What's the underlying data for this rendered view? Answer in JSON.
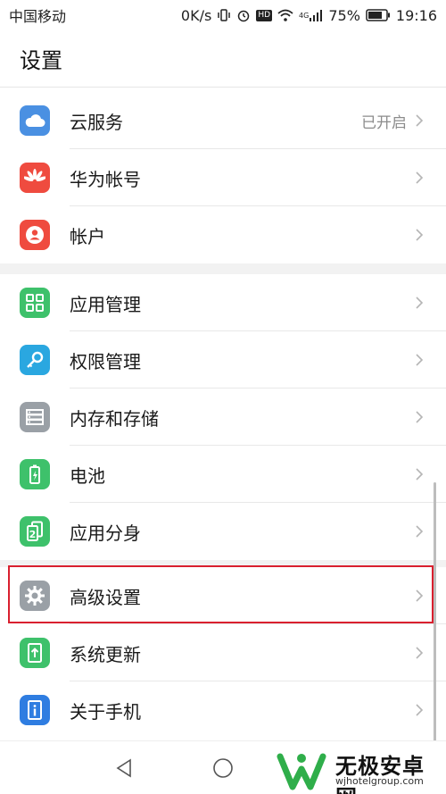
{
  "status_bar": {
    "carrier": "中国移动",
    "speed": "0K/s",
    "hd_badge": "HD",
    "network": "4G",
    "battery": "75%",
    "time": "19:16"
  },
  "header": {
    "title": "设置"
  },
  "groups": [
    {
      "items": [
        {
          "icon": "cloud-icon",
          "color": "#4a90e2",
          "label": "云服务",
          "value": "已开启"
        },
        {
          "icon": "huawei-logo-icon",
          "color": "#ef4b3f",
          "label": "华为帐号",
          "value": ""
        },
        {
          "icon": "user-icon",
          "color": "#ef4b3f",
          "label": "帐户",
          "value": ""
        }
      ]
    },
    {
      "items": [
        {
          "icon": "app-grid-icon",
          "color": "#3ec16b",
          "label": "应用管理",
          "value": ""
        },
        {
          "icon": "key-icon",
          "color": "#2aa7e0",
          "label": "权限管理",
          "value": ""
        },
        {
          "icon": "storage-icon",
          "color": "#9aa0a6",
          "label": "内存和存储",
          "value": ""
        },
        {
          "icon": "battery-icon",
          "color": "#3ec16b",
          "label": "电池",
          "value": ""
        },
        {
          "icon": "twin-app-icon",
          "color": "#3ec16b",
          "label": "应用分身",
          "value": ""
        }
      ]
    },
    {
      "items": [
        {
          "icon": "gear-icon",
          "color": "#9aa0a6",
          "label": "高级设置",
          "value": ""
        },
        {
          "icon": "system-update-icon",
          "color": "#3ec16b",
          "label": "系统更新",
          "value": ""
        },
        {
          "icon": "info-icon",
          "color": "#2f7de1",
          "label": "关于手机",
          "value": ""
        }
      ]
    }
  ],
  "watermark": {
    "name": "无极安卓网",
    "url": "wjhotelgroup.com"
  },
  "colors": {
    "highlight": "#d9202f",
    "divider": "#e8e8e8",
    "section_gap": "#f2f2f2"
  }
}
